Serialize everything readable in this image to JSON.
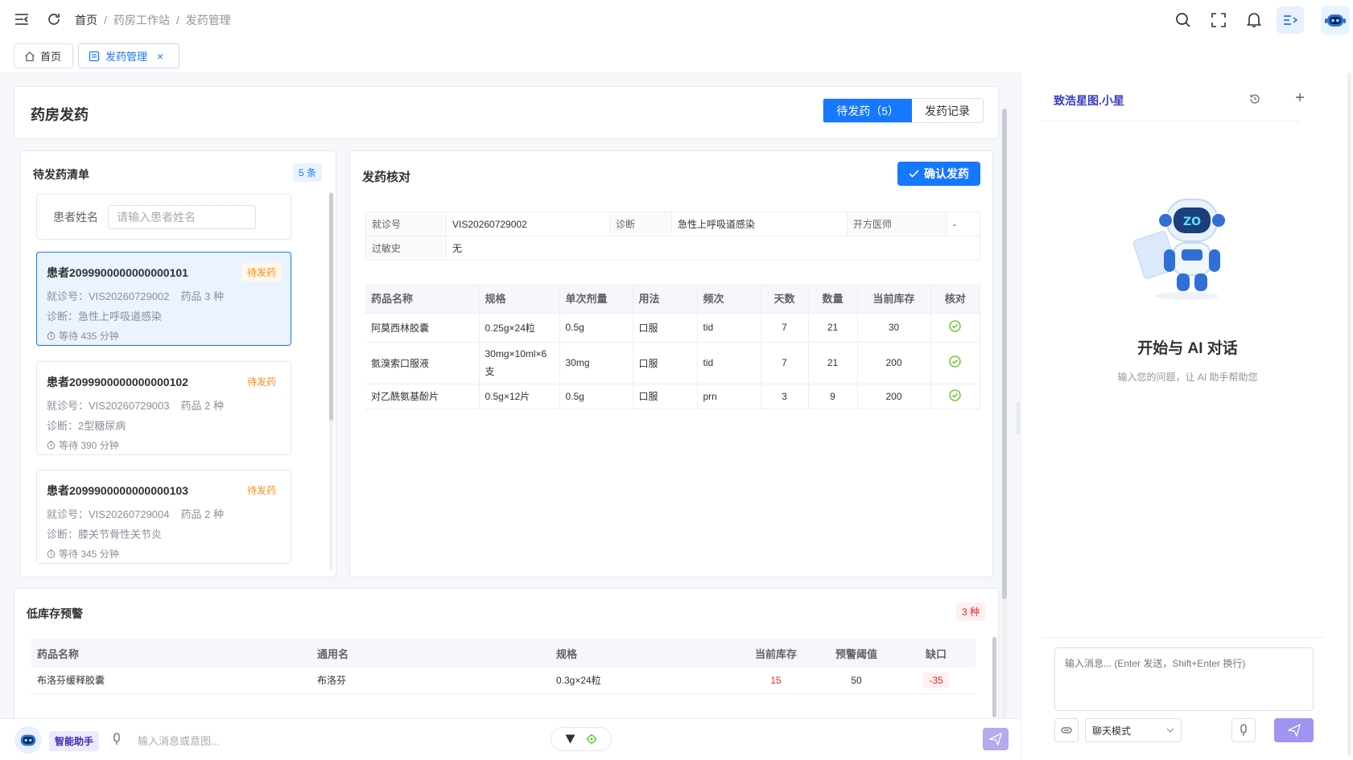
{
  "breadcrumb": [
    "首页",
    "药房工作站",
    "发药管理"
  ],
  "tabs": [
    {
      "label": "首页",
      "icon": "home-icon"
    },
    {
      "label": "发药管理",
      "icon": "document-icon",
      "close": "×"
    }
  ],
  "page": {
    "title": "药房发药",
    "segment": {
      "pending": "待发药（5）",
      "records": "发药记录"
    }
  },
  "queue": {
    "title": "待发药清单",
    "count_badge": "5 条",
    "search_label": "患者姓名",
    "search_placeholder": "请输入患者姓名",
    "patients": [
      {
        "name": "患者2099900000000000101",
        "status": "待发药",
        "visit": "就诊号：VIS20260729002",
        "drugs": "药品 3 种",
        "diagnosis": "诊断：急性上呼吸道感染",
        "wait": "等待 435 分钟"
      },
      {
        "name": "患者2099900000000000102",
        "status": "待发药",
        "visit": "就诊号：VIS20260729003",
        "drugs": "药品 2 种",
        "diagnosis": "诊断：2型糖尿病",
        "wait": "等待 390 分钟"
      },
      {
        "name": "患者2099900000000000103",
        "status": "待发药",
        "visit": "就诊号：VIS20260729004",
        "drugs": "药品 2 种",
        "diagnosis": "诊断：膝关节骨性关节炎",
        "wait": "等待 345 分钟"
      }
    ]
  },
  "verify": {
    "title": "发药核对",
    "confirm_button": "确认发药",
    "info": {
      "visit_label": "就诊号",
      "visit": "VIS20260729002",
      "diag_label": "诊断",
      "diag": "急性上呼吸道感染",
      "doctor_label": "开方医师",
      "doctor": "-",
      "allergy_label": "过敏史",
      "allergy": "无"
    },
    "columns": [
      "药品名称",
      "规格",
      "单次剂量",
      "用法",
      "频次",
      "天数",
      "数量",
      "当前库存",
      "核对"
    ],
    "rows": [
      {
        "name": "阿莫西林胶囊",
        "spec": "0.25g×24粒",
        "dose": "0.5g",
        "usage": "口服",
        "freq": "tid",
        "days": "7",
        "qty": "21",
        "stock": "30"
      },
      {
        "name": "氨溴索口服液",
        "spec": "30mg×10ml×6支",
        "dose": "30mg",
        "usage": "口服",
        "freq": "tid",
        "days": "7",
        "qty": "21",
        "stock": "200"
      },
      {
        "name": "对乙酰氨基酚片",
        "spec": "0.5g×12片",
        "dose": "0.5g",
        "usage": "口服",
        "freq": "prn",
        "days": "3",
        "qty": "9",
        "stock": "200"
      }
    ]
  },
  "low_stock": {
    "title": "低库存预警",
    "count_badge": "3 种",
    "columns": [
      "药品名称",
      "通用名",
      "规格",
      "当前库存",
      "预警阈值",
      "缺口"
    ],
    "rows": [
      {
        "name": "布洛芬缓释胶囊",
        "generic": "布洛芬",
        "spec": "0.3g×24粒",
        "stock": "15",
        "threshold": "50",
        "gap": "-35"
      }
    ]
  },
  "ai": {
    "title": "致浩星图.小星",
    "heading": "开始与 AI 对话",
    "subheading": "输入您的问题，让 AI 助手帮助您",
    "input_placeholder": "输入消息... (Enter 发送，Shift+Enter 换行)",
    "mode": "聊天模式"
  },
  "bottom": {
    "assistant_label": "智能助手",
    "input_placeholder": "输入消息或意图..."
  },
  "colors": {
    "primary": "#1677ff",
    "warning": "#fa8c16",
    "danger": "#f5222d",
    "success": "#52c41a"
  }
}
